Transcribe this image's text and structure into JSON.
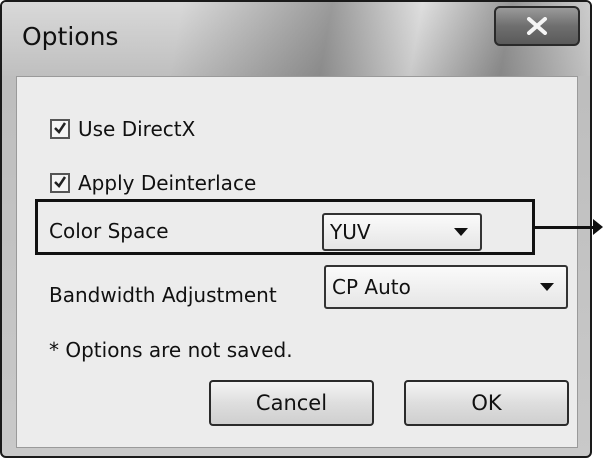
{
  "window": {
    "title": "Options",
    "close_symbol": "X"
  },
  "options": {
    "use_directx": {
      "label": "Use DirectX",
      "checked": true
    },
    "apply_deinterlace": {
      "label": "Apply Deinterlace",
      "checked": true
    },
    "color_space": {
      "label": "Color Space",
      "selected": "YUV"
    },
    "bandwidth": {
      "label": "Bandwidth Adjustment",
      "selected": "CP Auto"
    }
  },
  "note": "* Options are not saved.",
  "buttons": {
    "cancel": "Cancel",
    "ok": "OK"
  },
  "icons": {
    "close": "close-icon",
    "checkmark": "checkmark-icon",
    "dropdown": "chevron-down-icon",
    "callout": "arrow-right-icon"
  }
}
